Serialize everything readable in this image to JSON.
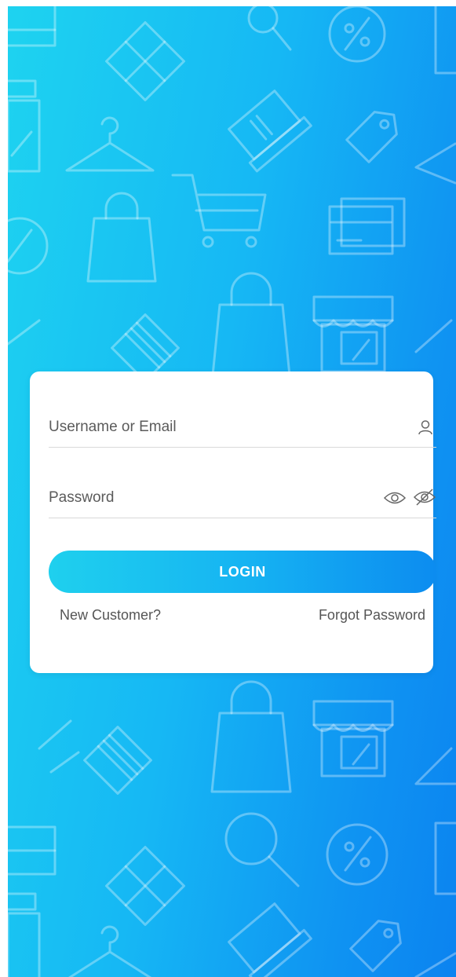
{
  "login_form": {
    "username_placeholder": "Username or Email",
    "password_placeholder": "Password",
    "login_button": "LOGIN",
    "new_customer_link": "New Customer?",
    "forgot_password_link": "Forgot Password"
  },
  "icons": {
    "username": "user-icon",
    "password_show": "eye-icon",
    "password_hide": "eye-slash-icon"
  },
  "colors": {
    "background_start": "#1ed3f0",
    "background_end": "#0b83f0",
    "button_start": "#1fd0ee",
    "button_end": "#0c8cf0",
    "card": "#ffffff"
  }
}
